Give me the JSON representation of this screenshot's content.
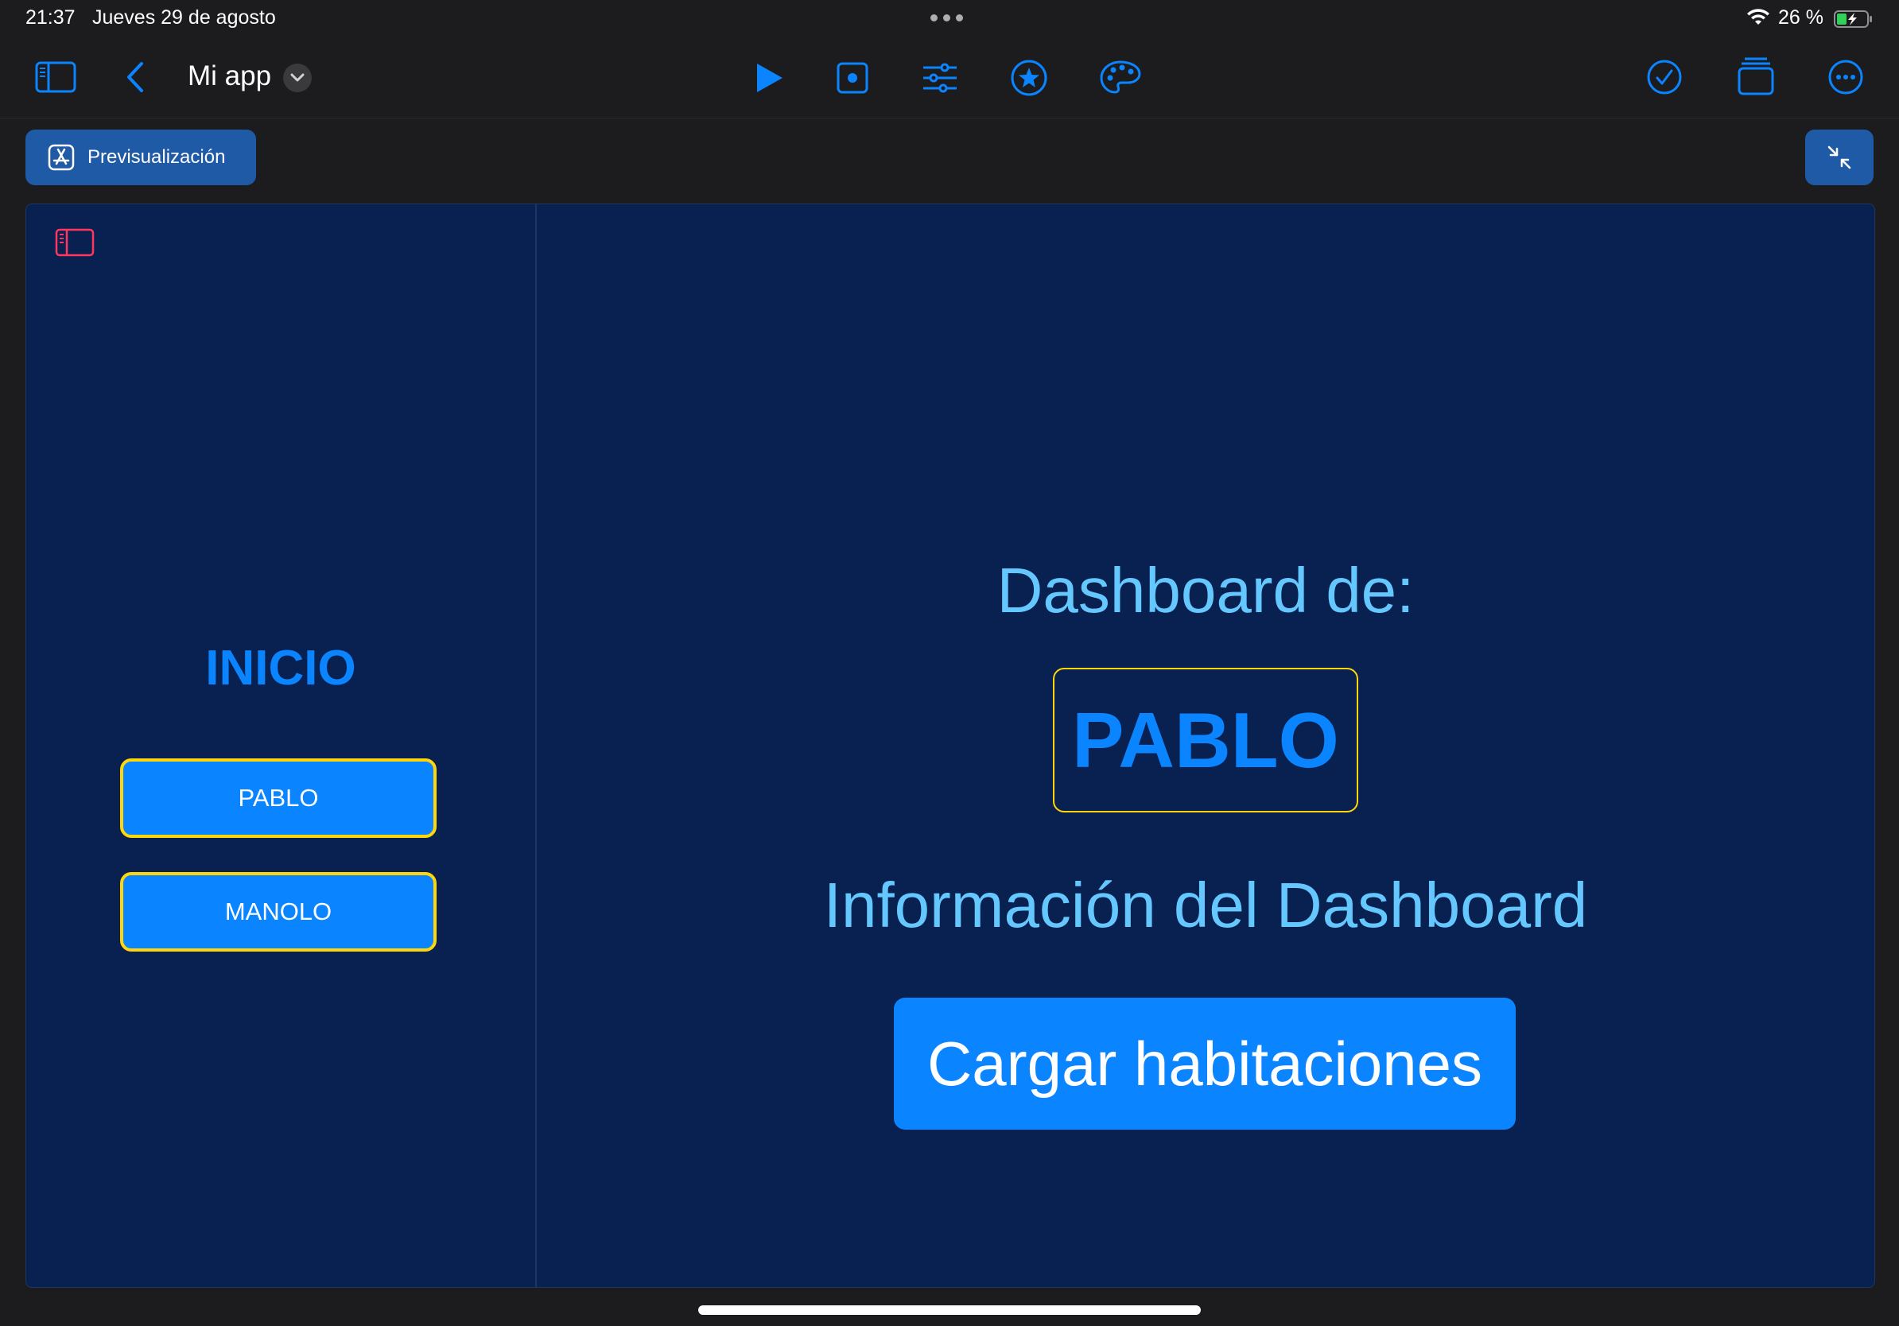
{
  "status_bar": {
    "time": "21:37",
    "date": "Jueves 29 de agosto",
    "battery": "26 %"
  },
  "toolbar": {
    "title": "Mi app",
    "icons": [
      "sidebar-icon",
      "back-chevron-icon",
      "title-dropdown-icon",
      "play-icon",
      "record-icon",
      "sliders-icon",
      "star-icon",
      "palette-icon",
      "checkmark-icon",
      "stack-icon",
      "more-icon"
    ]
  },
  "preview": {
    "label": "Previsualización"
  },
  "app": {
    "sidebar": {
      "heading": "INICIO",
      "buttons": [
        "PABLO",
        "MANOLO"
      ]
    },
    "detail": {
      "title": "Dashboard de:",
      "selected_name": "PABLO",
      "info": "Información del Dashboard",
      "load_button": "Cargar habitaciones"
    }
  },
  "colors": {
    "accent": "#0a84ff",
    "canvas_bg": "#082150",
    "highlight_border": "#ffd60a",
    "light_text": "#64c8ff",
    "toolbar_button_bg": "#1f5aa6"
  }
}
